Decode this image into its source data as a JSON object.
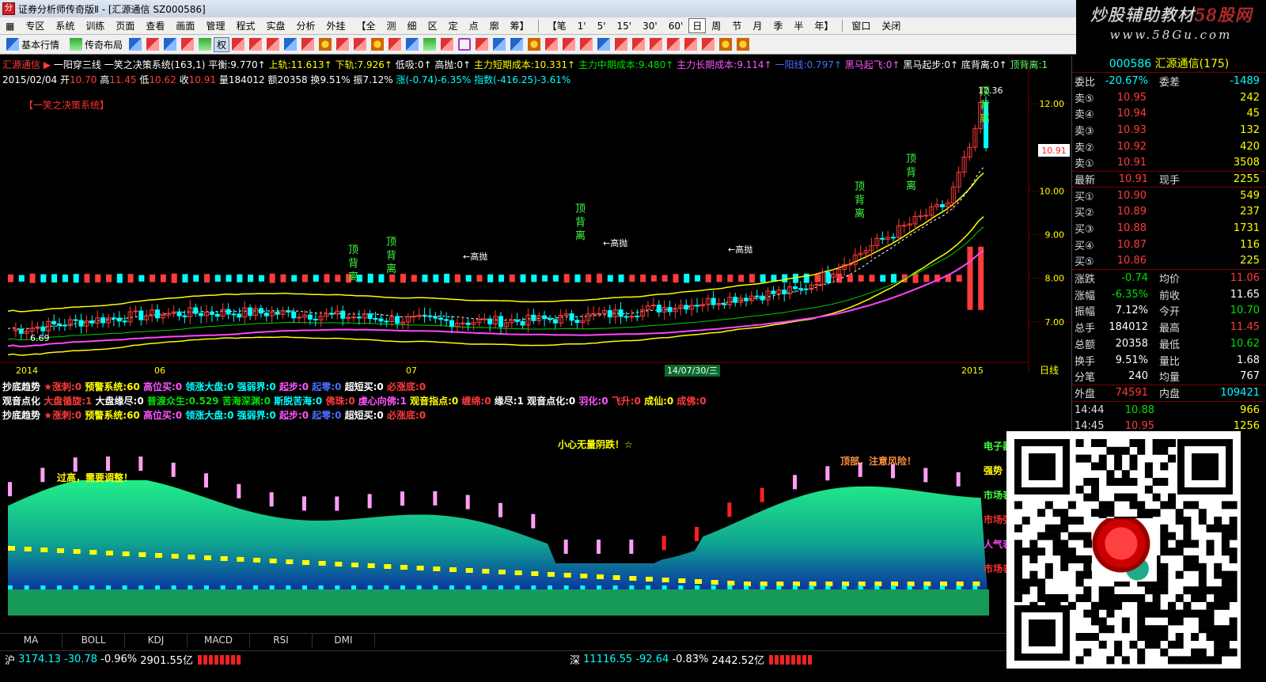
{
  "window": {
    "title": "证券分析师传奇版Ⅱ - [汇源通信 SZ000586]",
    "brand_line1": "炒股辅助教材",
    "brand_line1_red": "58股网",
    "brand_line2": "www.58Gu.com"
  },
  "menu": {
    "items": [
      "专区",
      "系统",
      "训练",
      "页面",
      "查看",
      "画面",
      "管理",
      "程式",
      "实盘",
      "分析",
      "外挂"
    ],
    "period_open": "【全",
    "periods_a": [
      "测",
      "细",
      "区",
      "定",
      "点",
      "廓",
      "筹】"
    ],
    "periods_b_open": "【笔",
    "periods_b": [
      "1'",
      "5'",
      "15'",
      "30'",
      "60'"
    ],
    "period_active": "日",
    "periods_c": [
      "周",
      "节",
      "月",
      "季",
      "半",
      "年】"
    ],
    "window_items": [
      "窗口",
      "关闭"
    ]
  },
  "toolbar": {
    "basic_quote": "基本行情",
    "legend_layout": "传奇布局",
    "quan": "权"
  },
  "info_bar": {
    "stock_name": "汇源通信",
    "system_name": "一阳穿三线 一笑之决策系统(163,1)",
    "items": [
      {
        "label": "平衡:",
        "value": "9.770",
        "color": "white"
      },
      {
        "label": "上轨:",
        "value": "11.613",
        "color": "yellow"
      },
      {
        "label": "下轨:",
        "value": "7.926",
        "color": "yellow"
      },
      {
        "label": "低吸:",
        "value": "0",
        "color": "white"
      },
      {
        "label": "高抛:",
        "value": "0",
        "color": "white"
      },
      {
        "label": "主力短期成本:",
        "value": "10.331",
        "color": "yellow"
      },
      {
        "label": "主力中期成本:",
        "value": "9.480",
        "color": "green"
      },
      {
        "label": "主力长期成本:",
        "value": "9.114",
        "color": "magenta"
      },
      {
        "label": "一阳线:",
        "value": "0.797",
        "color": "blue"
      },
      {
        "label": "黑马起飞:",
        "value": "0",
        "color": "magenta"
      },
      {
        "label": "黑马起步:",
        "value": "0",
        "color": "white"
      },
      {
        "label": "底背离:",
        "value": "0",
        "color": "white"
      },
      {
        "label": "顶背离:",
        "value": "1",
        "color": "lime"
      }
    ],
    "date": "2015/02/04",
    "open_label": "开",
    "open": "10.70",
    "high_label": "高",
    "high": "11.45",
    "low_label": "低",
    "low": "10.62",
    "close_label": "收",
    "close": "10.91",
    "vol_label": "量",
    "vol": "184012",
    "amount_label": "额",
    "amount": "20358",
    "turn_label": "换",
    "turn": "9.51%",
    "amp_label": "振",
    "amp": "7.12%",
    "chg": "涨(-0.74)-6.35%",
    "index": "指数(-416.25)-3.61%"
  },
  "kchart": {
    "system_tag": "【一笑之决策系统】",
    "y_ticks": [
      "12.00",
      "10.00",
      "9.00",
      "8.00",
      "7.00"
    ],
    "x_labels": [
      "2014",
      "06",
      "07",
      "2015"
    ],
    "cursor_date": "14/07/30/三",
    "current_price": "10.91",
    "peak": "12.36",
    "low": "6.69",
    "period": "日线",
    "signal_label": "顶背离",
    "high_throw": "←高抛"
  },
  "indicator_bars": [
    {
      "name": "抄底趋势",
      "items": [
        {
          "t": "★涨刺:0",
          "c": "red"
        },
        {
          "t": "预警系统:60",
          "c": "yellow"
        },
        {
          "t": "高位买:0",
          "c": "magenta"
        },
        {
          "t": "领涨大盘:0",
          "c": "cyan"
        },
        {
          "t": "强弱界:0",
          "c": "cyan"
        },
        {
          "t": "起步:0",
          "c": "magenta"
        },
        {
          "t": "起零:0",
          "c": "blue"
        },
        {
          "t": "超短买:0",
          "c": "white"
        },
        {
          "t": "必涨底:0",
          "c": "red"
        }
      ]
    },
    {
      "name": "观音点化",
      "items": [
        {
          "t": "大盘循旋:1",
          "c": "red"
        },
        {
          "t": "大盘缘尽:0",
          "c": "white"
        },
        {
          "t": "普渡众生:0.529",
          "c": "green"
        },
        {
          "t": "苦海深渊:0",
          "c": "green"
        },
        {
          "t": "斯脱苦海:0",
          "c": "cyan"
        },
        {
          "t": "佛珠:0",
          "c": "red"
        },
        {
          "t": "虔心向佛:1",
          "c": "magenta"
        },
        {
          "t": "观音指点:0",
          "c": "yellow"
        },
        {
          "t": "缠绵:0",
          "c": "red"
        },
        {
          "t": "缘尽:1",
          "c": "white"
        },
        {
          "t": "观音点化:0",
          "c": "white"
        },
        {
          "t": "羽化:0",
          "c": "magenta"
        },
        {
          "t": "飞升:0",
          "c": "red"
        },
        {
          "t": "成仙:0",
          "c": "yellow"
        },
        {
          "t": "成佛:0",
          "c": "red"
        }
      ]
    },
    {
      "name": "抄底趋势",
      "items": [
        {
          "t": "★涨刺:0",
          "c": "red"
        },
        {
          "t": "预警系统:60",
          "c": "yellow"
        },
        {
          "t": "高位买:0",
          "c": "magenta"
        },
        {
          "t": "领涨大盘:0",
          "c": "cyan"
        },
        {
          "t": "强弱界:0",
          "c": "cyan"
        },
        {
          "t": "起步:0",
          "c": "magenta"
        },
        {
          "t": "起零:0",
          "c": "blue"
        },
        {
          "t": "超短买:0",
          "c": "white"
        },
        {
          "t": "必涨底:0",
          "c": "red"
        }
      ]
    }
  ],
  "lower_chart": {
    "y_top": "100.00",
    "notes": [
      "小心无量阴跌！☆",
      "顶部，注意风险！",
      "过高，需要调整！"
    ],
    "side_labels": [
      "电子器",
      "强势",
      "市场表",
      "市场强",
      "人气表",
      "市场表"
    ]
  },
  "tabs": [
    "MA",
    "BOLL",
    "KDJ",
    "MACD",
    "RSI",
    "DMI"
  ],
  "status": {
    "sh_label": "沪",
    "sh_index": "3174.13",
    "sh_chg": "-30.78",
    "sh_pct": "-0.96%",
    "sh_amt": "2901.55亿",
    "sz_label": "深",
    "sz_index": "11116.55",
    "sz_chg": "-92.64",
    "sz_pct": "-0.83%",
    "sz_amt": "2442.52亿"
  },
  "quote": {
    "code": "000586",
    "name": "汇源通信",
    "num": "(175)",
    "webi_label": "委比",
    "webi": "-20.67%",
    "wecha_label": "委差",
    "wecha": "-1489",
    "asks": [
      {
        "lbl": "卖⑤",
        "px": "10.95",
        "vol": "242"
      },
      {
        "lbl": "卖④",
        "px": "10.94",
        "vol": "45"
      },
      {
        "lbl": "卖③",
        "px": "10.93",
        "vol": "132"
      },
      {
        "lbl": "卖②",
        "px": "10.92",
        "vol": "420"
      },
      {
        "lbl": "卖①",
        "px": "10.91",
        "vol": "3508"
      }
    ],
    "last_label": "最新",
    "last": "10.91",
    "cur_label": "现手",
    "cur": "2255",
    "bids": [
      {
        "lbl": "买①",
        "px": "10.90",
        "vol": "549"
      },
      {
        "lbl": "买②",
        "px": "10.89",
        "vol": "237"
      },
      {
        "lbl": "买③",
        "px": "10.88",
        "vol": "1731"
      },
      {
        "lbl": "买④",
        "px": "10.87",
        "vol": "116"
      },
      {
        "lbl": "买⑤",
        "px": "10.86",
        "vol": "225"
      }
    ],
    "stats": [
      {
        "k1": "涨跌",
        "v1": "-0.74",
        "c1": "green",
        "k2": "均价",
        "v2": "11.06",
        "c2": "red"
      },
      {
        "k1": "涨幅",
        "v1": "-6.35%",
        "c1": "green",
        "k2": "前收",
        "v2": "11.65",
        "c2": "white"
      },
      {
        "k1": "振幅",
        "v1": "7.12%",
        "c1": "white",
        "k2": "今开",
        "v2": "10.70",
        "c2": "green"
      },
      {
        "k1": "总手",
        "v1": "184012",
        "c1": "white",
        "k2": "最高",
        "v2": "11.45",
        "c2": "red"
      },
      {
        "k1": "总额",
        "v1": "20358",
        "c1": "white",
        "k2": "最低",
        "v2": "10.62",
        "c2": "green"
      },
      {
        "k1": "换手",
        "v1": "9.51%",
        "c1": "white",
        "k2": "量比",
        "v2": "1.68",
        "c2": "white"
      },
      {
        "k1": "分笔",
        "v1": "240",
        "c1": "white",
        "k2": "均量",
        "v2": "767",
        "c2": "white"
      }
    ],
    "outer_label": "外盘",
    "outer": "74591",
    "inner_label": "内盘",
    "inner": "109421",
    "ticks": [
      {
        "t": "14:44",
        "p": "10.88",
        "c": "green",
        "v": "966"
      },
      {
        "t": "14:45",
        "p": "10.95",
        "c": "red",
        "v": "1256"
      }
    ]
  },
  "colors": {
    "up": "#ff3b3b",
    "down": "#00ffff",
    "ma_yellow": "#ffff00",
    "ma_magenta": "#ff44ff",
    "ma_white": "#ffffff",
    "ma_green": "#00d000"
  }
}
